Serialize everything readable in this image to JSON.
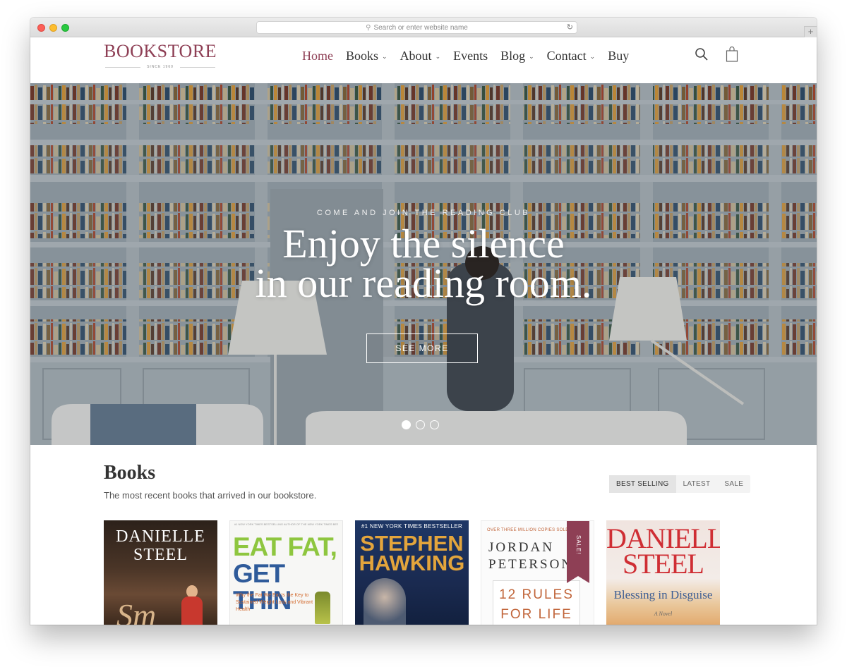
{
  "browser": {
    "address_placeholder": "Search or enter website name",
    "new_tab_label": "+"
  },
  "site": {
    "logo": "BOOKSTORE",
    "logo_tagline": "SINCE 1960",
    "brand_color": "#8e3f55"
  },
  "nav": {
    "items": [
      {
        "label": "Home",
        "active": true,
        "has_dropdown": false
      },
      {
        "label": "Books",
        "active": false,
        "has_dropdown": true
      },
      {
        "label": "About",
        "active": false,
        "has_dropdown": true
      },
      {
        "label": "Events",
        "active": false,
        "has_dropdown": false
      },
      {
        "label": "Blog",
        "active": false,
        "has_dropdown": true
      },
      {
        "label": "Contact",
        "active": false,
        "has_dropdown": true
      },
      {
        "label": "Buy",
        "active": false,
        "has_dropdown": false
      }
    ],
    "icons": [
      "search-icon",
      "shopping-bag-icon"
    ]
  },
  "hero": {
    "kicker": "COME AND JOIN THE READING CLUB",
    "title_line1": "Enjoy the silence",
    "title_line2": "in our reading room.",
    "button": "SEE MORE",
    "slides": 3,
    "active_slide": 1
  },
  "books": {
    "title": "Books",
    "subtitle": "The most recent books that arrived in our bookstore.",
    "tabs": [
      {
        "label": "BEST SELLING",
        "active": true
      },
      {
        "label": "LATEST",
        "active": false
      },
      {
        "label": "SALE",
        "active": false
      }
    ],
    "covers": {
      "c1": {
        "author_line1": "DANIELLE",
        "author_line2": "STEEL",
        "script": "Sm"
      },
      "c2": {
        "tiny": "#1 NEW YORK TIMES BESTSELLING AUTHOR OF THE NEW YORK TIMES BESTSELLER",
        "title_line1": "EAT FAT,",
        "title_line2": "GET THIN",
        "desc": "Why the Fat We Eat Is the Key to Sustained Weight Loss and Vibrant Health"
      },
      "c3": {
        "badge": "#1 NEW YORK TIMES BESTSELLER",
        "author_line1": "STEPHEN",
        "author_line2": "HAWKING"
      },
      "c4": {
        "top": "OVER THREE MILLION COPIES SOLD",
        "author_line1": "JORDAN",
        "author_line2": "PETERSON",
        "title_line1": "12 RULES",
        "title_line2": "FOR LIFE",
        "ribbon": "SALE!"
      },
      "c5": {
        "author_line1": "DANIELLE",
        "author_line2": "STEEL",
        "title": "Blessing in Disguise",
        "subtitle": "A Novel"
      }
    }
  }
}
